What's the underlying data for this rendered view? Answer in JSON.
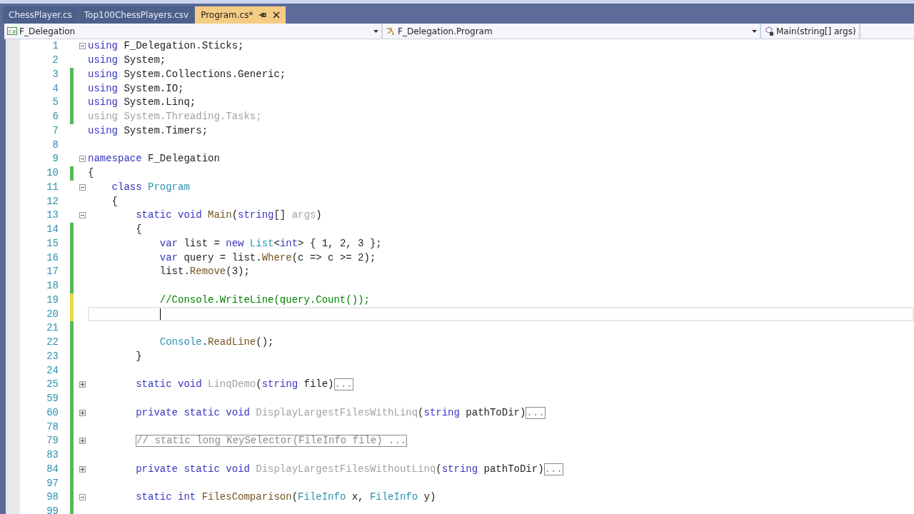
{
  "tabs": [
    {
      "label": "ChessPlayer.cs",
      "selected": false,
      "pinned": false
    },
    {
      "label": "Top100ChessPlayers.csv",
      "selected": false,
      "pinned": false
    },
    {
      "label": "Program.cs*",
      "selected": true,
      "pinned": true
    }
  ],
  "navigation": [
    {
      "kind": "project",
      "icon_text": "C#",
      "label": "F_Delegation"
    },
    {
      "kind": "class",
      "label": "F_Delegation.Program"
    },
    {
      "kind": "member",
      "label": "Main(string[] args)"
    }
  ],
  "lines": [
    {
      "number": "1",
      "collapsible": true,
      "expanded": true,
      "tokens": [
        {
          "kind": "kw",
          "text": "using"
        },
        {
          "kind": "plain",
          "text": " F_Delegation.Sticks;"
        }
      ]
    },
    {
      "number": "2",
      "collapsible": false,
      "tokens": [
        {
          "kind": "kw",
          "text": "using"
        },
        {
          "kind": "plain",
          "text": " System;"
        }
      ]
    },
    {
      "number": "3",
      "color": "#57b85c",
      "collapsible": false,
      "tokens": [
        {
          "kind": "kw",
          "text": "using"
        },
        {
          "kind": "plain",
          "text": " System.Collections.Generic;"
        }
      ]
    },
    {
      "number": "4",
      "color": "#57b85c",
      "collapsible": false,
      "tokens": [
        {
          "kind": "kw",
          "text": "using"
        },
        {
          "kind": "plain",
          "text": " System.IO;"
        }
      ]
    },
    {
      "number": "5",
      "color": "#57b85c",
      "collapsible": false,
      "tokens": [
        {
          "kind": "kw",
          "text": "using"
        },
        {
          "kind": "plain",
          "text": " System.Linq;"
        }
      ]
    },
    {
      "number": "6",
      "color": "#57b85c",
      "collapsible": false,
      "tokens": [
        {
          "kind": "unused",
          "text": "using System.Threading.Tasks;"
        }
      ]
    },
    {
      "number": "7",
      "collapsible": false,
      "tokens": [
        {
          "kind": "kw",
          "text": "using"
        },
        {
          "kind": "plain",
          "text": " System.Timers;"
        }
      ]
    },
    {
      "number": "8",
      "collapsible": false
    },
    {
      "number": "9",
      "collapsible": true,
      "expanded": true,
      "tokens": [
        {
          "kind": "kw",
          "text": "namespace"
        },
        {
          "kind": "plain",
          "text": " F_Delegation"
        }
      ]
    },
    {
      "number": "10",
      "color": "#57b85c",
      "collapsible": false,
      "tokens": [
        {
          "kind": "plain",
          "text": "{"
        }
      ]
    },
    {
      "number": "11",
      "collapsible": true,
      "expanded": true,
      "tokens": [
        {
          "kind": "kw",
          "text": "    class "
        },
        {
          "kind": "type",
          "text": "Program"
        }
      ]
    },
    {
      "number": "12",
      "collapsible": false,
      "tokens": [
        {
          "kind": "plain",
          "text": "    {"
        }
      ]
    },
    {
      "number": "13",
      "collapsible": true,
      "expanded": true,
      "tokens": [
        {
          "kind": "kw",
          "text": "        static void "
        },
        {
          "kind": "method",
          "text": "Main"
        },
        {
          "kind": "plain",
          "text": "("
        },
        {
          "kind": "kw",
          "text": "string"
        },
        {
          "kind": "plain",
          "text": "[] "
        },
        {
          "kind": "unused",
          "text": "args"
        },
        {
          "kind": "plain",
          "text": ")"
        }
      ]
    },
    {
      "number": "14",
      "color": "#57b85c",
      "collapsible": false,
      "tokens": [
        {
          "kind": "plain",
          "text": "        {"
        }
      ]
    },
    {
      "number": "15",
      "color": "#57b85c",
      "collapsible": false,
      "tokens": [
        {
          "kind": "kw",
          "text": "            var"
        },
        {
          "kind": "plain",
          "text": " list = "
        },
        {
          "kind": "kw",
          "text": "new "
        },
        {
          "kind": "type",
          "text": "List"
        },
        {
          "kind": "plain",
          "text": "<"
        },
        {
          "kind": "kw",
          "text": "int"
        },
        {
          "kind": "plain",
          "text": "> { 1, 2, 3 };"
        }
      ]
    },
    {
      "number": "16",
      "color": "#57b85c",
      "collapsible": false,
      "tokens": [
        {
          "kind": "kw",
          "text": "            var"
        },
        {
          "kind": "plain",
          "text": " query = list."
        },
        {
          "kind": "method",
          "text": "Where"
        },
        {
          "kind": "plain",
          "text": "(c => c >= 2);"
        }
      ]
    },
    {
      "number": "17",
      "color": "#57b85c",
      "collapsible": false,
      "tokens": [
        {
          "kind": "plain",
          "text": "            list."
        },
        {
          "kind": "method",
          "text": "Remove"
        },
        {
          "kind": "plain",
          "text": "(3);"
        }
      ]
    },
    {
      "number": "18",
      "color": "#57b85c",
      "collapsible": false
    },
    {
      "number": "19",
      "color": "#efd84a",
      "collapsible": false,
      "tokens": [
        {
          "kind": "comment",
          "text": "            //Console.WriteLine(query.Count());"
        }
      ]
    },
    {
      "number": "20",
      "color": "#efd84a",
      "collapsible": false,
      "current": true
    },
    {
      "number": "21",
      "color": "#57b85c",
      "collapsible": false
    },
    {
      "number": "22",
      "color": "#57b85c",
      "collapsible": false,
      "tokens": [
        {
          "kind": "type",
          "text": "            Console"
        },
        {
          "kind": "plain",
          "text": "."
        },
        {
          "kind": "method",
          "text": "ReadLine"
        },
        {
          "kind": "plain",
          "text": "();"
        }
      ]
    },
    {
      "number": "23",
      "color": "#57b85c",
      "collapsible": false,
      "tokens": [
        {
          "kind": "plain",
          "text": "        }"
        }
      ]
    },
    {
      "number": "24",
      "color": "#57b85c",
      "collapsible": false
    },
    {
      "number": "25",
      "color": "#57b85c",
      "collapsible": true,
      "expanded": false,
      "tokens": [
        {
          "kind": "kw",
          "text": "        static void "
        },
        {
          "kind": "unused",
          "text": "LinqDemo"
        },
        {
          "kind": "plain",
          "text": "("
        },
        {
          "kind": "kw",
          "text": "string"
        },
        {
          "kind": "plain",
          "text": " file)"
        },
        {
          "kind": "collapsed",
          "text": "..."
        }
      ]
    },
    {
      "number": "59",
      "color": "#57b85c",
      "collapsible": false
    },
    {
      "number": "60",
      "color": "#57b85c",
      "collapsible": true,
      "expanded": false,
      "tokens": [
        {
          "kind": "kw",
          "text": "        private static void "
        },
        {
          "kind": "unused",
          "text": "DisplayLargestFilesWithLinq"
        },
        {
          "kind": "plain",
          "text": "("
        },
        {
          "kind": "kw",
          "text": "string"
        },
        {
          "kind": "plain",
          "text": " pathToDir)"
        },
        {
          "kind": "collapsed",
          "text": "..."
        }
      ]
    },
    {
      "number": "78",
      "color": "#57b85c",
      "collapsible": false
    },
    {
      "number": "79",
      "color": "#57b85c",
      "collapsible": true,
      "expanded": false,
      "tokens": [
        {
          "kind": "collapsed",
          "text": "// static long KeySelector(FileInfo file) ..."
        }
      ]
    },
    {
      "number": "83",
      "color": "#57b85c",
      "collapsible": false
    },
    {
      "number": "84",
      "color": "#57b85c",
      "collapsible": true,
      "expanded": false,
      "tokens": [
        {
          "kind": "kw",
          "text": "        private static void "
        },
        {
          "kind": "unused",
          "text": "DisplayLargestFilesWithoutLinq"
        },
        {
          "kind": "plain",
          "text": "("
        },
        {
          "kind": "kw",
          "text": "string"
        },
        {
          "kind": "plain",
          "text": " pathToDir)"
        },
        {
          "kind": "collapsed",
          "text": "..."
        }
      ]
    },
    {
      "number": "97",
      "color": "#57b85c",
      "collapsible": false
    },
    {
      "number": "98",
      "color": "#57b85c",
      "collapsible": true,
      "expanded": true,
      "tokens": [
        {
          "kind": "kw",
          "text": "        static int "
        },
        {
          "kind": "method",
          "text": "FilesComparison"
        },
        {
          "kind": "plain",
          "text": "("
        },
        {
          "kind": "type",
          "text": "FileInfo"
        },
        {
          "kind": "plain",
          "text": " x, "
        },
        {
          "kind": "type",
          "text": "FileInfo"
        },
        {
          "kind": "plain",
          "text": " y)"
        }
      ]
    },
    {
      "number": "99",
      "color": "#57b85c",
      "collapsible": false
    }
  ]
}
